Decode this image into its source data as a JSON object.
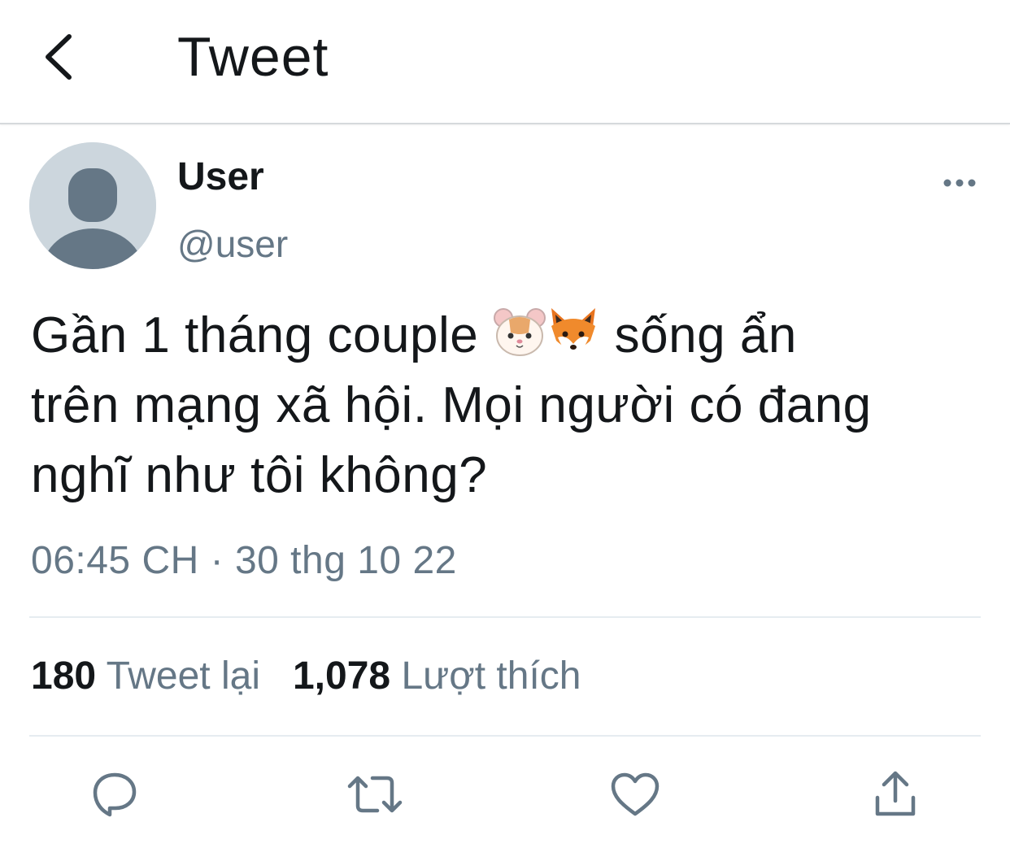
{
  "header": {
    "title": "Tweet",
    "back_icon": "chevron-left-icon"
  },
  "author": {
    "display_name": "User",
    "handle": "@user",
    "avatar_icon": "default-avatar-icon"
  },
  "tweet": {
    "text_line1_before": "Gần 1 tháng couple ",
    "emojis": [
      "hamster-face-emoji",
      "fox-face-emoji"
    ],
    "text_line1_after": " sống ẩn",
    "text_line2": "trên mạng xã hội. Mọi người có đang",
    "text_line3": "nghĩ như tôi không?",
    "timestamp": "06:45 CH · 30 thg 10 22"
  },
  "stats": {
    "retweets_count": "180",
    "retweets_label": "Tweet lại",
    "likes_count": "1,078",
    "likes_label": "Lượt thích"
  },
  "actions": {
    "reply_icon": "reply-icon",
    "retweet_icon": "retweet-icon",
    "like_icon": "heart-icon",
    "share_icon": "share-icon"
  },
  "colors": {
    "text_primary": "#14171a",
    "text_secondary": "#657786",
    "divider": "#e6ecf0",
    "avatar_bg": "#ccd6dd",
    "avatar_fg": "#657786"
  }
}
